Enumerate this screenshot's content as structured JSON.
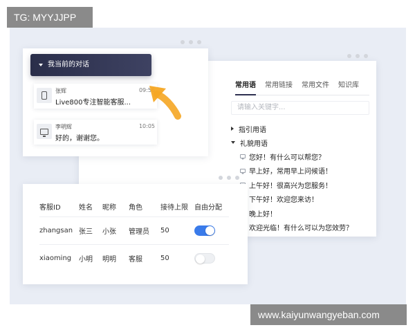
{
  "watermarks": {
    "tag": "TG: MYYJJPP",
    "url": "www.kaiyunwangyeban.com"
  },
  "knowledge": {
    "tabs": [
      {
        "label": "常用语",
        "active": true
      },
      {
        "label": "常用链接",
        "active": false
      },
      {
        "label": "常用文件",
        "active": false
      },
      {
        "label": "知识库",
        "active": false
      }
    ],
    "search_placeholder": "请输入关键字...",
    "groups": [
      {
        "label": "指引用语",
        "expanded": false
      },
      {
        "label": "礼貌用语",
        "expanded": true
      }
    ],
    "phrases": [
      "您好！有什么可以帮您？",
      "早上好，常用早上问候语！",
      "上午好！很高兴为您服务！",
      "下午好！欢迎您来访！",
      "晚上好！",
      "欢迎光临！有什么可以为您效劳？"
    ]
  },
  "conversations": {
    "header_title": "我当前的对话",
    "items": [
      {
        "name": "张辉",
        "message": "Live800专注智能客服...",
        "time": "09:56",
        "device_icon": "phone-icon"
      },
      {
        "name": "李明辉",
        "message": "好的，谢谢您。",
        "time": "10:05",
        "device_icon": "monitor-icon"
      }
    ]
  },
  "staff": {
    "columns": [
      "客服ID",
      "姓名",
      "昵称",
      "角色",
      "接待上限",
      "自由分配"
    ],
    "rows": [
      {
        "id": "zhangsan",
        "name": "张三",
        "nickname": "小张",
        "role": "管理员",
        "limit": "50",
        "auto_assign": true
      },
      {
        "id": "xiaoming",
        "name": "小明",
        "nickname": "明明",
        "role": "客服",
        "limit": "50",
        "auto_assign": false
      }
    ]
  },
  "colors": {
    "header_dark": "#2a2e4a",
    "toggle_on": "#3a7bea",
    "arrow": "#f5a623",
    "backdrop": "#e9edf5"
  }
}
